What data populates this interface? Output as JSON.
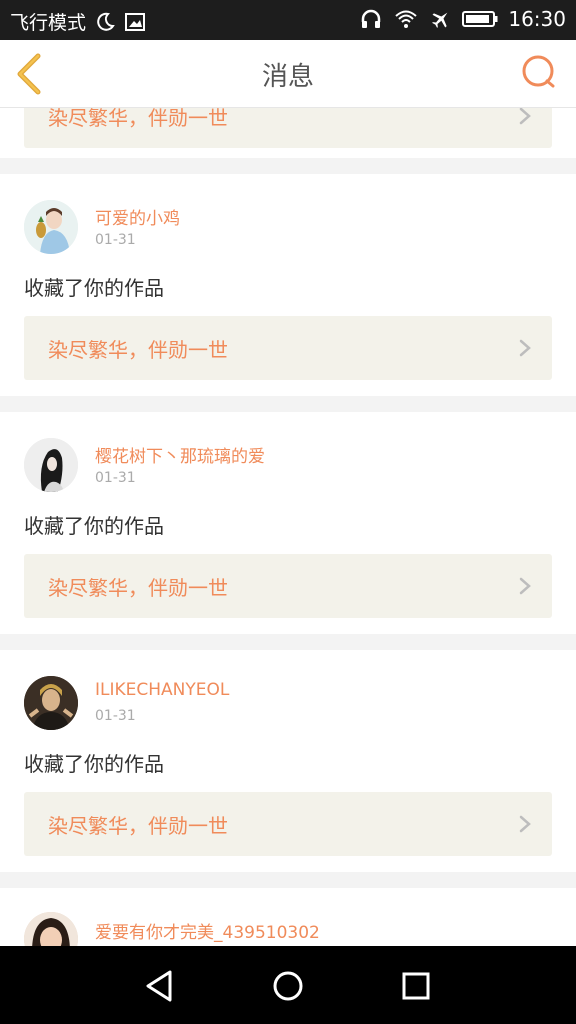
{
  "status_bar": {
    "mode": "飞行模式",
    "time": "16:30",
    "icons": [
      "moon-icon",
      "image-icon",
      "headphones-icon",
      "wifi-icon",
      "airplane-icon",
      "battery-icon"
    ]
  },
  "header": {
    "title": "消息",
    "back_icon": "chevron-left-icon",
    "search_icon": "search-icon",
    "accent": "#f08b5a"
  },
  "partial_top": {
    "work_title": "染尽繁华，伴勋一世"
  },
  "messages": [
    {
      "user": "可爱的小鸡",
      "date": "01-31",
      "action": "收藏了你的作品",
      "work_title": "染尽繁华，伴勋一世"
    },
    {
      "user": "樱花树下丶那琉璃的爱",
      "date": "01-31",
      "action": "收藏了你的作品",
      "work_title": "染尽繁华，伴勋一世"
    },
    {
      "user": "ILIKECHANYEOL",
      "date": "01-31",
      "action": "收藏了你的作品",
      "work_title": "染尽繁华，伴勋一世"
    },
    {
      "user": "爱要有你才完美_439510302"
    }
  ],
  "nav_bar": {
    "icons": [
      "back-triangle-icon",
      "home-circle-icon",
      "recents-square-icon"
    ]
  }
}
